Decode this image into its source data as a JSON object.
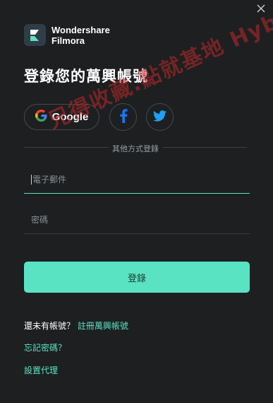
{
  "window": {
    "close_glyph": "✕"
  },
  "brand": {
    "name_line1": "Wondershare",
    "name_line2": "Filmora"
  },
  "title": "登錄您的萬興帳號",
  "social": {
    "google_label": "Google",
    "facebook_glyph": "f"
  },
  "divider_text": "其他方式登錄",
  "form": {
    "email_placeholder": "電子郵件",
    "password_placeholder": "密碼",
    "login_label": "登錄"
  },
  "links": {
    "no_account_text": "還未有帳號？",
    "register_label": "註冊萬興帳號",
    "forgot_label": "忘記密碼？",
    "proxy_label": "設置代理"
  },
  "watermark": "兄得收藏.點就基地 Hybase.co",
  "colors": {
    "background": "#1d1f21",
    "accent": "#5ae3c3",
    "facebook": "#1877f2",
    "twitter": "#1da1f2",
    "watermark": "#be2828"
  }
}
